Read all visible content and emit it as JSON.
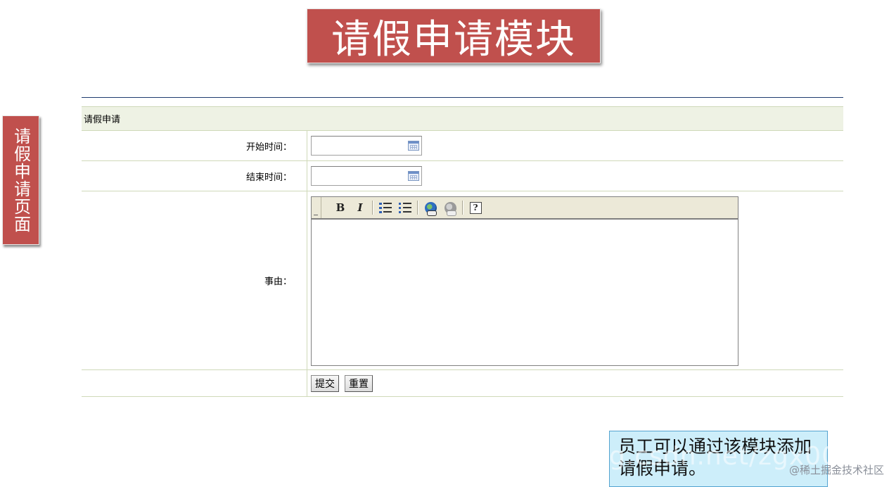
{
  "slide": {
    "title": "请假申请模块",
    "side_label": "请假申请页面",
    "callout": "员工可以通过该模块添加请假申请。"
  },
  "form": {
    "header": "请假申请",
    "start_label": "开始时间：",
    "end_label": "结束时间：",
    "reason_label": "事由：",
    "start_value": "",
    "end_value": "",
    "submit_label": "提交",
    "reset_label": "重置"
  },
  "editor": {
    "toolbar": [
      "bold-icon",
      "italic-icon",
      "ordered-list-icon",
      "unordered-list-icon",
      "link-icon",
      "unlink-icon",
      "help-icon"
    ],
    "bold_glyph": "B",
    "italic_glyph": "I",
    "help_glyph": "?",
    "content": ""
  },
  "watermark": {
    "url": "g.csdn.net/zgx002",
    "site": "@稀土掘金技术社区"
  },
  "colors": {
    "banner": "#c0504d",
    "callout_bg": "#cdeefa",
    "form_header_bg": "#eef2e4",
    "toolbar_bg": "#ece9d8"
  }
}
